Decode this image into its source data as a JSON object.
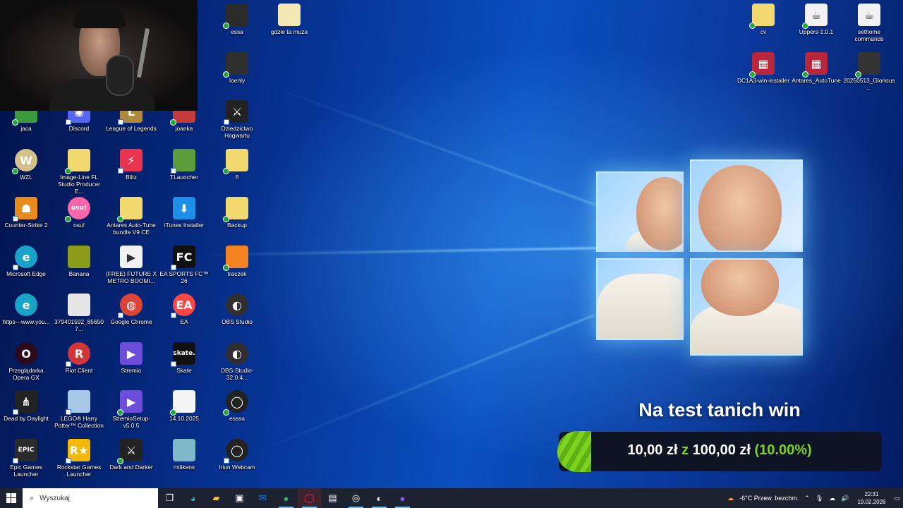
{
  "desktop": {
    "icons": [
      {
        "id": "essa",
        "label": "essa",
        "glyph": "",
        "bg": "#2a2a2a",
        "sync": true,
        "shortcut": false
      },
      {
        "id": "gdzie",
        "label": "gdzie ta muza",
        "glyph": "",
        "bg": "#f4e9b4",
        "sync": false,
        "shortcut": false
      },
      {
        "id": "ioenly",
        "label": "Ioenly",
        "glyph": "",
        "bg": "#2f2f2f",
        "sync": true,
        "shortcut": false
      },
      {
        "id": "jaca",
        "label": "jaca",
        "glyph": "",
        "bg": "#3a9b3a",
        "sync": true,
        "shortcut": false
      },
      {
        "id": "discord",
        "label": "Discord",
        "glyph": "◉",
        "bg": "#5865f2",
        "sync": false,
        "shortcut": true
      },
      {
        "id": "lol",
        "label": "League of Legends",
        "glyph": "L",
        "bg": "#b08a3a",
        "sync": false,
        "shortcut": true
      },
      {
        "id": "joanka",
        "label": "joanka",
        "glyph": "",
        "bg": "#c63a3a",
        "sync": true,
        "shortcut": false
      },
      {
        "id": "hogwart",
        "label": "Dziedzictwo Hogwartu",
        "glyph": "⚔",
        "bg": "#222",
        "sync": false,
        "shortcut": true
      },
      {
        "id": "wzl",
        "label": "WZL",
        "glyph": "W",
        "bg": "#d4c089",
        "sync": true,
        "shortcut": false
      },
      {
        "id": "flstudio",
        "label": "Image-Line FL Studio Producer E...",
        "glyph": "",
        "bg": "#f1d970",
        "sync": true,
        "shortcut": false
      },
      {
        "id": "blitz",
        "label": "Blitz",
        "glyph": "⚡",
        "bg": "#e8344e",
        "sync": false,
        "shortcut": true
      },
      {
        "id": "tlauncher",
        "label": "TLauncher",
        "glyph": "",
        "bg": "#5c9d3b",
        "sync": false,
        "shortcut": true
      },
      {
        "id": "fl",
        "label": "fl",
        "glyph": "",
        "bg": "#f1d970",
        "sync": true,
        "shortcut": false
      },
      {
        "id": "cs2",
        "label": "Counter-Strike 2",
        "glyph": "☗",
        "bg": "#e88b1d",
        "sync": false,
        "shortcut": true
      },
      {
        "id": "osu",
        "label": "osu!",
        "glyph": "osu!",
        "bg": "#ff66aa",
        "sync": true,
        "shortcut": false
      },
      {
        "id": "antares1",
        "label": "Antares Auto-Tune bundle V9 CE",
        "glyph": "",
        "bg": "#f1d970",
        "sync": true,
        "shortcut": false
      },
      {
        "id": "itunes",
        "label": "iTunes Installer",
        "glyph": "⬇",
        "bg": "#1d8fe8",
        "sync": false,
        "shortcut": false
      },
      {
        "id": "backup",
        "label": "Backup",
        "glyph": "",
        "bg": "#f1d970",
        "sync": true,
        "shortcut": false
      },
      {
        "id": "edge",
        "label": "Microsoft Edge",
        "glyph": "e",
        "bg": "#1aa3c9",
        "sync": false,
        "shortcut": true
      },
      {
        "id": "banana",
        "label": "Banana",
        "glyph": "",
        "bg": "#8a9b18",
        "sync": false,
        "shortcut": false
      },
      {
        "id": "future",
        "label": "(FREE) FUTURE X METRO BOOMI...",
        "glyph": "▶",
        "bg": "#f2f2f2",
        "sync": false,
        "shortcut": false
      },
      {
        "id": "fc26",
        "label": "EA SPORTS FC™ 26",
        "glyph": "FC",
        "bg": "#111",
        "sync": false,
        "shortcut": true
      },
      {
        "id": "traczek",
        "label": "traczek",
        "glyph": "",
        "bg": "#f58220",
        "sync": true,
        "shortcut": false
      },
      {
        "id": "youtube",
        "label": "https---www.you...",
        "glyph": "e",
        "bg": "#1aa3c9",
        "sync": false,
        "shortcut": false
      },
      {
        "id": "photo",
        "label": "379401592_856507...",
        "glyph": "",
        "bg": "#e6e6e6",
        "sync": false,
        "shortcut": false
      },
      {
        "id": "chrome",
        "label": "Google Chrome",
        "glyph": "◍",
        "bg": "#db4437",
        "sync": false,
        "shortcut": true
      },
      {
        "id": "ea",
        "label": "EA",
        "glyph": "EA",
        "bg": "#ff4747",
        "sync": false,
        "shortcut": true
      },
      {
        "id": "obs",
        "label": "OBS Studio",
        "glyph": "◐",
        "bg": "#302e31",
        "sync": false,
        "shortcut": false
      },
      {
        "id": "opera",
        "label": "Przeglądarka Opera GX",
        "glyph": "O",
        "bg": "#2b0a1e",
        "sync": false,
        "shortcut": false
      },
      {
        "id": "riot",
        "label": "Riot Client",
        "glyph": "R",
        "bg": "#d13639",
        "sync": false,
        "shortcut": true
      },
      {
        "id": "stremio",
        "label": "Stremio",
        "glyph": "▶",
        "bg": "#6c4ddb",
        "sync": false,
        "shortcut": false
      },
      {
        "id": "skate",
        "label": "Skate",
        "glyph": "skate.",
        "bg": "#111",
        "sync": false,
        "shortcut": true
      },
      {
        "id": "obs32",
        "label": "OBS-Studio-32.0.4...",
        "glyph": "◐",
        "bg": "#302e31",
        "sync": false,
        "shortcut": false
      },
      {
        "id": "dbd",
        "label": "Dead by Daylight",
        "glyph": "⋔",
        "bg": "#222",
        "sync": false,
        "shortcut": true
      },
      {
        "id": "lego",
        "label": "LEGO® Harry Potter™ Collection",
        "glyph": "",
        "bg": "#a7c8e6",
        "sync": false,
        "shortcut": true
      },
      {
        "id": "stremiosetup",
        "label": "StremioSetup-v5.0.5",
        "glyph": "▶",
        "bg": "#6c4ddb",
        "sync": true,
        "shortcut": false
      },
      {
        "id": "date",
        "label": "14.10.2025",
        "glyph": "",
        "bg": "#f5f5f5",
        "sync": true,
        "shortcut": false
      },
      {
        "id": "esssa",
        "label": "esssa",
        "glyph": "◯",
        "bg": "#222",
        "sync": true,
        "shortcut": false
      },
      {
        "id": "epic",
        "label": "Epic Games Launcher",
        "glyph": "EPIC",
        "bg": "#2a2a2a",
        "sync": false,
        "shortcut": true
      },
      {
        "id": "rockstar",
        "label": "Rockstar Games Launcher",
        "glyph": "R★",
        "bg": "#f5b800",
        "sync": false,
        "shortcut": true
      },
      {
        "id": "darker",
        "label": "Dark and Darker",
        "glyph": "⚔",
        "bg": "#222",
        "sync": true,
        "shortcut": false
      },
      {
        "id": "milikens",
        "label": "milikens",
        "glyph": "",
        "bg": "#7fb9c9",
        "sync": false,
        "shortcut": false
      },
      {
        "id": "iriun",
        "label": "Iriun Webcam",
        "glyph": "◯",
        "bg": "#222",
        "sync": false,
        "shortcut": true
      },
      {
        "id": "cv",
        "label": "cv",
        "glyph": "",
        "bg": "#f1d970",
        "sync": true,
        "shortcut": false
      },
      {
        "id": "uppers",
        "label": "Uppers-1.0.1",
        "glyph": "☕",
        "bg": "#f2f2f2",
        "sync": true,
        "shortcut": false
      },
      {
        "id": "sethome",
        "label": "sethome commands",
        "glyph": "☕",
        "bg": "#f2f2f2",
        "sync": false,
        "shortcut": false
      },
      {
        "id": "dc1a3",
        "label": "DC1A3-win-installer",
        "glyph": "▦",
        "bg": "#b8263b",
        "sync": true,
        "shortcut": false
      },
      {
        "id": "antares2",
        "label": "Antares_AutoTune",
        "glyph": "▦",
        "bg": "#b8263b",
        "sync": true,
        "shortcut": false
      },
      {
        "id": "glorious",
        "label": "20250513_Glorious...",
        "glyph": "",
        "bg": "#333",
        "sync": true,
        "shortcut": false
      }
    ]
  },
  "overlay": {
    "title": "Na test tanich win",
    "amount": "10,00 zł",
    "of_word": "z",
    "total": "100,00 zł",
    "percent": "(10.00%)",
    "accent": "#7ed321"
  },
  "taskbar": {
    "search_placeholder": "Wyszukaj",
    "apps": [
      "task-view",
      "edge",
      "file-explorer",
      "store",
      "outlook",
      "spotify",
      "opera-gx",
      "photos",
      "iriun",
      "obs",
      "discord-ptb"
    ],
    "weather": "-6°C  Przew. bezchm.",
    "time": "22:31",
    "date": "19.02.2026"
  }
}
